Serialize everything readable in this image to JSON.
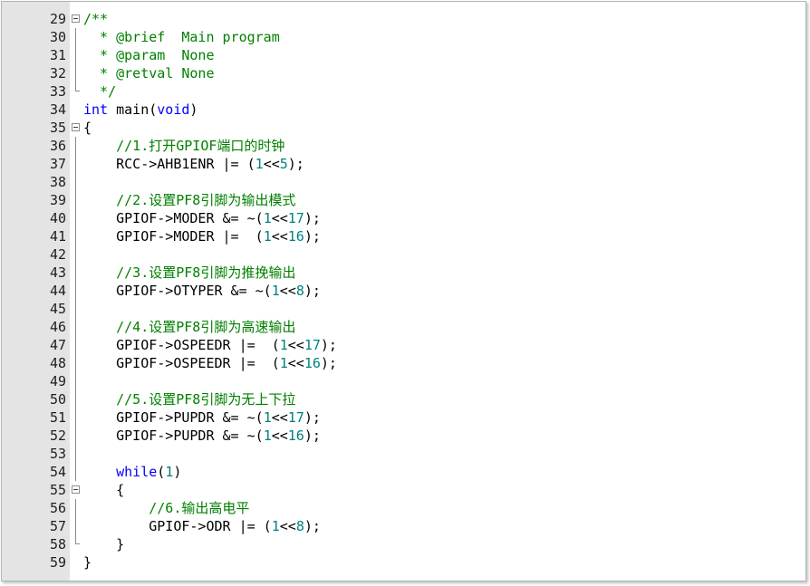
{
  "editor": {
    "colors": {
      "line_number": "#1e1e1e",
      "comment": "#008000",
      "keyword": "#0000ff",
      "number": "#008080",
      "text": "#000000",
      "gutter": "#e4e4e4"
    },
    "lines": [
      {
        "n": "29",
        "fold": "open",
        "tokens": [
          {
            "t": "/**",
            "c": "cm"
          }
        ]
      },
      {
        "n": "30",
        "fold": "line",
        "tokens": [
          {
            "t": "  * @brief  Main program",
            "c": "cm"
          }
        ]
      },
      {
        "n": "31",
        "fold": "line",
        "tokens": [
          {
            "t": "  * @param  None",
            "c": "cm"
          }
        ]
      },
      {
        "n": "32",
        "fold": "line",
        "tokens": [
          {
            "t": "  * @retval None",
            "c": "cm"
          }
        ]
      },
      {
        "n": "33",
        "fold": "end",
        "tokens": [
          {
            "t": "  */",
            "c": "cm"
          }
        ]
      },
      {
        "n": "34",
        "fold": "",
        "tokens": [
          {
            "t": "int",
            "c": "kw"
          },
          {
            "t": " main(",
            "c": ""
          },
          {
            "t": "void",
            "c": "kw"
          },
          {
            "t": ")",
            "c": ""
          }
        ]
      },
      {
        "n": "35",
        "fold": "open",
        "tokens": [
          {
            "t": "{",
            "c": ""
          }
        ]
      },
      {
        "n": "36",
        "fold": "line",
        "tokens": [
          {
            "t": "    ",
            "c": ""
          },
          {
            "t": "//1.打开GPIOF端口的时钟",
            "c": "cm"
          }
        ]
      },
      {
        "n": "37",
        "fold": "line",
        "tokens": [
          {
            "t": "    RCC->AHB1ENR |= (",
            "c": ""
          },
          {
            "t": "1",
            "c": "num"
          },
          {
            "t": "<<",
            "c": ""
          },
          {
            "t": "5",
            "c": "num"
          },
          {
            "t": ");",
            "c": ""
          }
        ]
      },
      {
        "n": "38",
        "fold": "line",
        "tokens": []
      },
      {
        "n": "39",
        "fold": "line",
        "tokens": [
          {
            "t": "    ",
            "c": ""
          },
          {
            "t": "//2.设置PF8引脚为输出模式",
            "c": "cm"
          }
        ]
      },
      {
        "n": "40",
        "fold": "line",
        "tokens": [
          {
            "t": "    GPIOF->MODER &= ~(",
            "c": ""
          },
          {
            "t": "1",
            "c": "num"
          },
          {
            "t": "<<",
            "c": ""
          },
          {
            "t": "17",
            "c": "num"
          },
          {
            "t": ");",
            "c": ""
          }
        ]
      },
      {
        "n": "41",
        "fold": "line",
        "tokens": [
          {
            "t": "    GPIOF->MODER |=  (",
            "c": ""
          },
          {
            "t": "1",
            "c": "num"
          },
          {
            "t": "<<",
            "c": ""
          },
          {
            "t": "16",
            "c": "num"
          },
          {
            "t": ");",
            "c": ""
          }
        ]
      },
      {
        "n": "42",
        "fold": "line",
        "tokens": []
      },
      {
        "n": "43",
        "fold": "line",
        "tokens": [
          {
            "t": "    ",
            "c": ""
          },
          {
            "t": "//3.设置PF8引脚为推挽输出",
            "c": "cm"
          }
        ]
      },
      {
        "n": "44",
        "fold": "line",
        "tokens": [
          {
            "t": "    GPIOF->OTYPER &= ~(",
            "c": ""
          },
          {
            "t": "1",
            "c": "num"
          },
          {
            "t": "<<",
            "c": ""
          },
          {
            "t": "8",
            "c": "num"
          },
          {
            "t": ");",
            "c": ""
          }
        ]
      },
      {
        "n": "45",
        "fold": "line",
        "tokens": []
      },
      {
        "n": "46",
        "fold": "line",
        "tokens": [
          {
            "t": "    ",
            "c": ""
          },
          {
            "t": "//4.设置PF8引脚为高速输出",
            "c": "cm"
          }
        ]
      },
      {
        "n": "47",
        "fold": "line",
        "tokens": [
          {
            "t": "    GPIOF->OSPEEDR |=  (",
            "c": ""
          },
          {
            "t": "1",
            "c": "num"
          },
          {
            "t": "<<",
            "c": ""
          },
          {
            "t": "17",
            "c": "num"
          },
          {
            "t": ");",
            "c": ""
          }
        ]
      },
      {
        "n": "48",
        "fold": "line",
        "tokens": [
          {
            "t": "    GPIOF->OSPEEDR |=  (",
            "c": ""
          },
          {
            "t": "1",
            "c": "num"
          },
          {
            "t": "<<",
            "c": ""
          },
          {
            "t": "16",
            "c": "num"
          },
          {
            "t": ");",
            "c": ""
          }
        ]
      },
      {
        "n": "49",
        "fold": "line",
        "tokens": []
      },
      {
        "n": "50",
        "fold": "line",
        "tokens": [
          {
            "t": "    ",
            "c": ""
          },
          {
            "t": "//5.设置PF8引脚为无上下拉",
            "c": "cm"
          }
        ]
      },
      {
        "n": "51",
        "fold": "line",
        "tokens": [
          {
            "t": "    GPIOF->PUPDR &= ~(",
            "c": ""
          },
          {
            "t": "1",
            "c": "num"
          },
          {
            "t": "<<",
            "c": ""
          },
          {
            "t": "17",
            "c": "num"
          },
          {
            "t": ");",
            "c": ""
          }
        ]
      },
      {
        "n": "52",
        "fold": "line",
        "tokens": [
          {
            "t": "    GPIOF->PUPDR &= ~(",
            "c": ""
          },
          {
            "t": "1",
            "c": "num"
          },
          {
            "t": "<<",
            "c": ""
          },
          {
            "t": "16",
            "c": "num"
          },
          {
            "t": ");",
            "c": ""
          }
        ]
      },
      {
        "n": "53",
        "fold": "line",
        "tokens": []
      },
      {
        "n": "54",
        "fold": "line",
        "tokens": [
          {
            "t": "    ",
            "c": ""
          },
          {
            "t": "while",
            "c": "kw"
          },
          {
            "t": "(",
            "c": ""
          },
          {
            "t": "1",
            "c": "num"
          },
          {
            "t": ")",
            "c": ""
          }
        ]
      },
      {
        "n": "55",
        "fold": "open",
        "tokens": [
          {
            "t": "    {",
            "c": ""
          }
        ]
      },
      {
        "n": "56",
        "fold": "line",
        "tokens": [
          {
            "t": "        ",
            "c": ""
          },
          {
            "t": "//6.输出高电平",
            "c": "cm"
          }
        ]
      },
      {
        "n": "57",
        "fold": "line",
        "tokens": [
          {
            "t": "        GPIOF->ODR |= (",
            "c": ""
          },
          {
            "t": "1",
            "c": "num"
          },
          {
            "t": "<<",
            "c": ""
          },
          {
            "t": "8",
            "c": "num"
          },
          {
            "t": ");",
            "c": ""
          }
        ]
      },
      {
        "n": "58",
        "fold": "end",
        "tokens": [
          {
            "t": "    }",
            "c": ""
          }
        ]
      },
      {
        "n": "59",
        "fold": "",
        "tokens": [
          {
            "t": "}",
            "c": ""
          }
        ]
      }
    ]
  }
}
